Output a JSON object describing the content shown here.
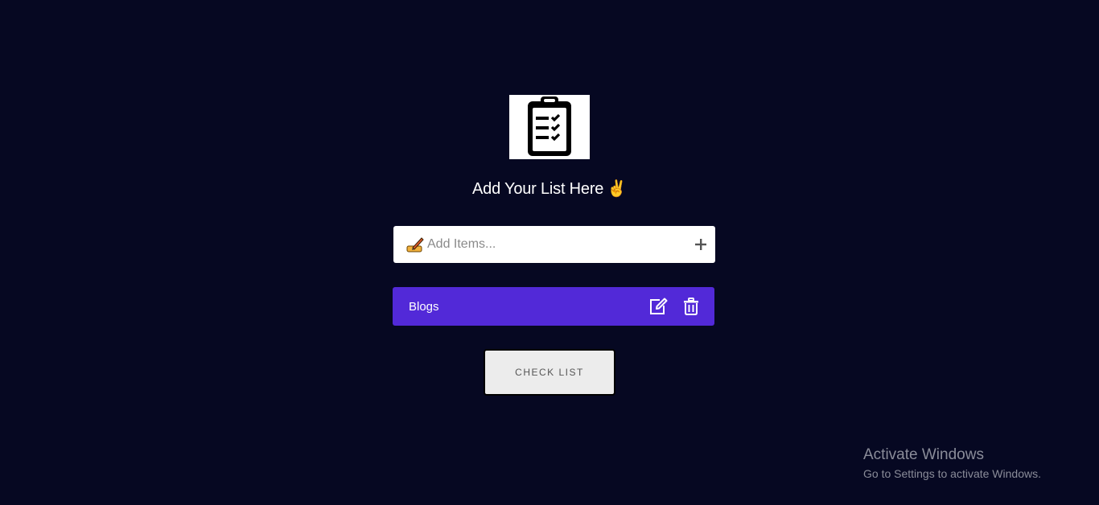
{
  "heading": {
    "text": "Add Your List Here",
    "emoji": "✌️"
  },
  "add_input": {
    "placeholder": "Add Items...",
    "value": ""
  },
  "items": [
    {
      "label": "Blogs"
    }
  ],
  "check_button": {
    "label": "Check List"
  },
  "watermark": {
    "title": "Activate Windows",
    "subtitle": "Go to Settings to activate Windows."
  },
  "icons": {
    "logo": "clipboard-checklist-icon",
    "input_prefix": "writing-hand-icon",
    "add": "plus-icon",
    "edit": "edit-icon",
    "delete": "trash-icon"
  },
  "colors": {
    "background": "#060822",
    "item_background": "#5229d8",
    "button_background": "#ececec"
  }
}
